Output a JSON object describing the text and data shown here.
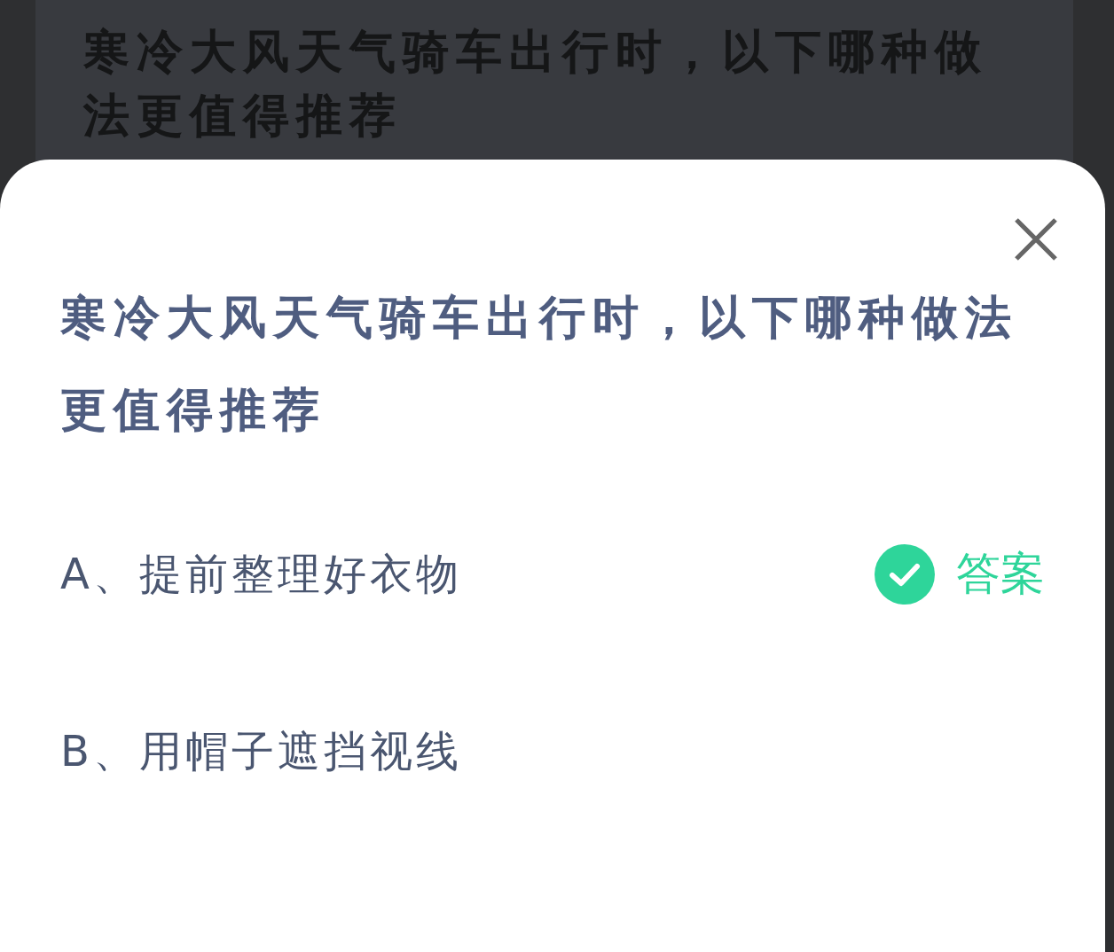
{
  "background_card": {
    "question": "寒冷大风天气骑车出行时，以下哪种做法更值得推荐"
  },
  "sheet": {
    "question": "寒冷大风天气骑车出行时，以下哪种做法更值得推荐",
    "options": [
      {
        "label": "A、提前整理好衣物",
        "correct": true,
        "badge": "答案"
      },
      {
        "label": "B、用帽子遮挡视线",
        "correct": false
      }
    ]
  }
}
